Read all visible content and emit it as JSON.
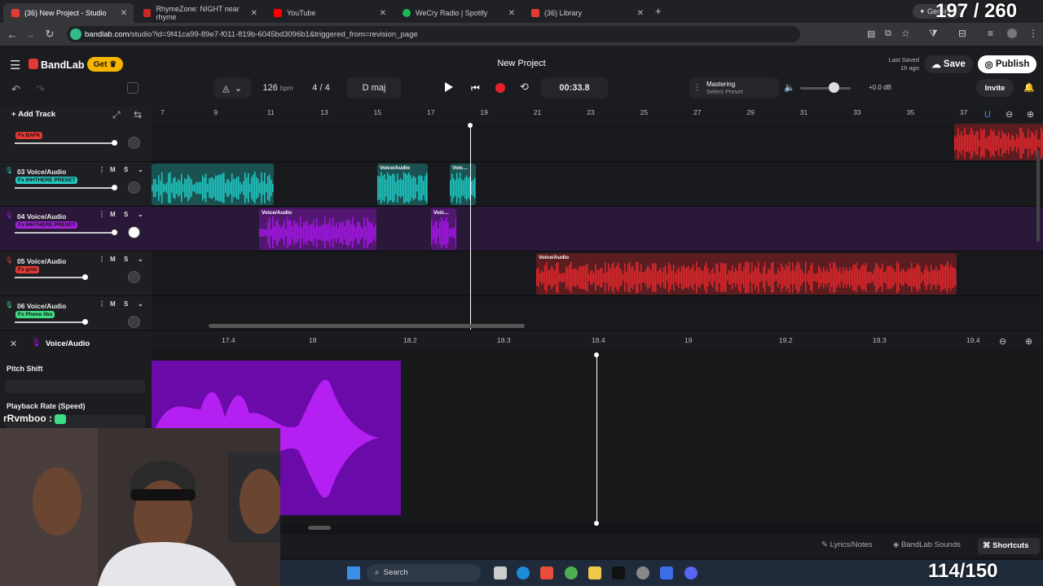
{
  "browser": {
    "tabs": [
      {
        "label": "(36) New Project - Studio",
        "color": "#e53935",
        "active": true
      },
      {
        "label": "RhymeZone: NIGHT near rhyme",
        "color": "#c62828",
        "active": false
      },
      {
        "label": "YouTube",
        "color": "#ff0000",
        "active": false
      },
      {
        "label": "WeCry Radio | Spotify",
        "color": "#1db954",
        "active": false
      },
      {
        "label": "(36) Library",
        "color": "#e53935",
        "active": false
      }
    ],
    "new_tab": "+",
    "gemini_label": "Gemini",
    "url_host": "bandlab.com",
    "url_path": "/studio?id=9f41ca99-89e7-f011-819b-6045bd3096b1&triggered_from=revision_page"
  },
  "overlay": {
    "top_counter": "197 / 260",
    "bottom_counter": "114/150",
    "chat_user": "rRvmboo :"
  },
  "header": {
    "brand": "BandLab",
    "get_label": "Get",
    "project_title": "New Project",
    "last_saved_label": "Last Saved",
    "last_saved_time": "1h ago",
    "save_label": "Save",
    "publish_label": "Publish",
    "invite_label": "Invite"
  },
  "transport": {
    "tempo": "126",
    "tempo_unit": "bpm",
    "time_sig": "4 / 4",
    "key": "D maj",
    "time": "00:33.8",
    "mastering_label": "Mastering",
    "mastering_preset": "Select Preset",
    "volume_db": "+0.0 dB"
  },
  "toolbar": {
    "add_track_label": "Add Track"
  },
  "ruler_ticks": [
    "7",
    "9",
    "11",
    "13",
    "15",
    "17",
    "19",
    "21",
    "23",
    "25",
    "27",
    "29",
    "31",
    "33",
    "35",
    "37"
  ],
  "tracks": [
    {
      "num": "",
      "name": "",
      "fx": "Fx BAFK",
      "fx_color": "#e53935",
      "lane_color": "#18191c",
      "vol": 0.85
    },
    {
      "num": "03",
      "name": "Voice/Audio",
      "fx": "Fx IHHTHERE PRESET",
      "fx_color": "#26c6c0",
      "lane_color": "#18191c",
      "vol": 0.85
    },
    {
      "num": "04",
      "name": "Voice/Audio",
      "fx": "Fx IHHTHERE PRESET",
      "fx_color": "#a020d8",
      "lane_color": "#2a1838",
      "vol": 0.85
    },
    {
      "num": "05",
      "name": "Voice/Audio",
      "fx": "Fx grim",
      "fx_color": "#e53935",
      "lane_color": "#18191c",
      "vol": 0.6
    },
    {
      "num": "06",
      "name": "Voice/Audio",
      "fx": "Fx Phone libs",
      "fx_color": "#3ddc84",
      "lane_color": "#18191c",
      "vol": 0.6
    }
  ],
  "track_buttons": {
    "mute": "M",
    "solo": "S"
  },
  "clip_label": "Voice/Audio",
  "clip_label_short": "Voic...",
  "editor": {
    "title": "Voice/Audio",
    "pitch_shift_label": "Pitch Shift",
    "playback_rate_label": "Playback Rate (Speed)",
    "ruler_ticks": [
      "17.4",
      "18",
      "18.2",
      "18.3",
      "18.4",
      "19",
      "19.2",
      "19.3",
      "19.4"
    ]
  },
  "bottombar": {
    "lyrics_label": "Lyrics/Notes",
    "sounds_label": "BandLab Sounds",
    "shortcuts_label": "Shortcuts"
  },
  "taskbar": {
    "search_label": "Search"
  },
  "colors": {
    "teal": "#1fc7c1",
    "purple": "#a516e8",
    "red": "#e0262b",
    "accent_yellow": "#f7b500"
  }
}
